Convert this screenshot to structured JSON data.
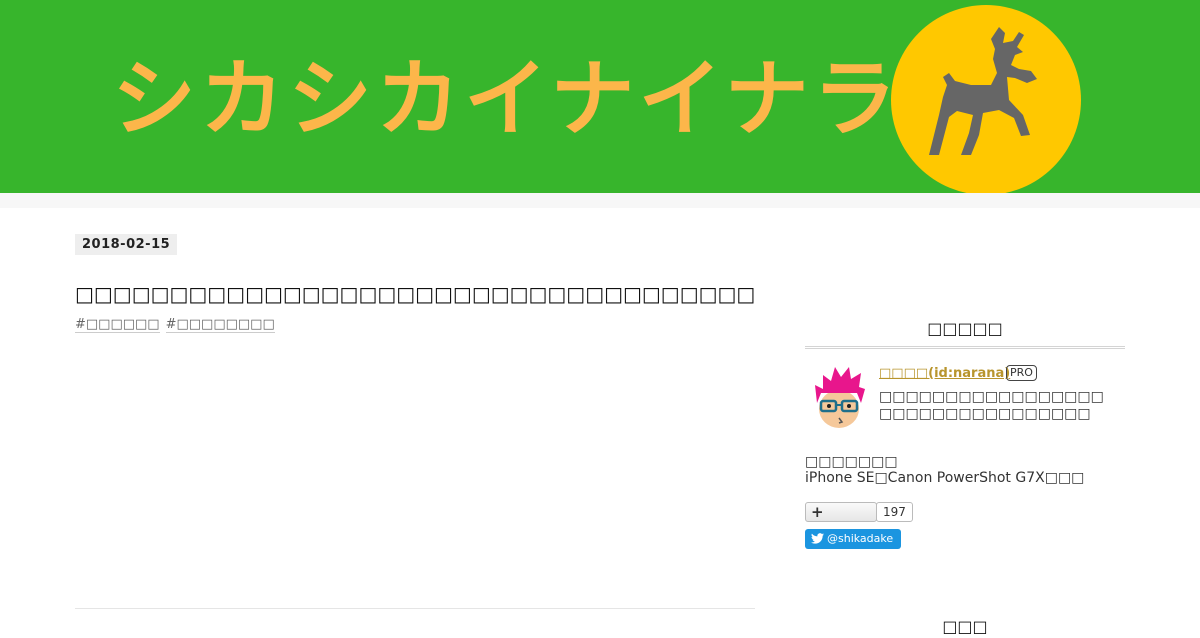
{
  "banner": {
    "title": "シカシカイナイナラ",
    "background_color": "#37b52c",
    "title_color": "#fcb64a",
    "logo_circle_color": "#ffc800",
    "logo_icon": "deer-icon"
  },
  "entry": {
    "date": "2018-02-15",
    "title": "□□□□□□□□□□□□□□□□□□□□□□□□□□□□□□□□□□□□",
    "tags": [
      "#□□□□□□",
      "#□□□□□□□□"
    ]
  },
  "sidebar": {
    "profile_heading": "□□□□□",
    "profile": {
      "name": "□□□□(id:narana)",
      "badge": "PRO",
      "desc_line1": "□□□□□□□□□□□□□□□□□",
      "desc_line2": "□□□□□□□□□□□□□□□□",
      "camera_label": "□□□□□□□",
      "camera_text": "iPhone SE□Canon PowerShot G7X□□□",
      "follow_icon": "plus-icon",
      "follow_count": "197",
      "twitter_icon": "twitter-bird-icon",
      "twitter_handle": "@shikadake"
    },
    "next_heading": "□□□"
  }
}
